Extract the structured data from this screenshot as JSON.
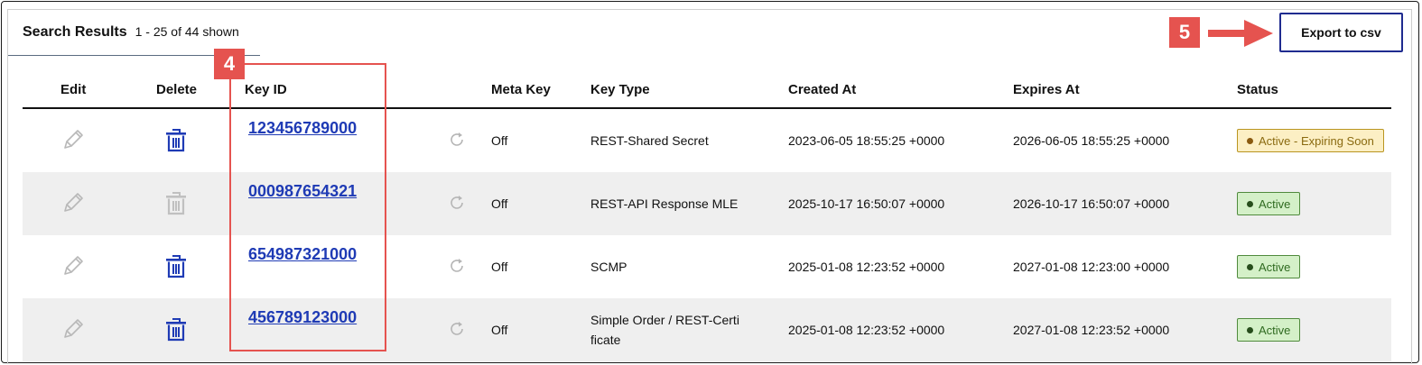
{
  "results": {
    "title": "Search Results",
    "count": "1 - 25 of 44 shown"
  },
  "toolbar": {
    "export_label": "Export to csv"
  },
  "callouts": {
    "export": "5",
    "key_id": "4"
  },
  "columns": {
    "edit": "Edit",
    "delete": "Delete",
    "key_id": "Key ID",
    "meta_key": "Meta Key",
    "key_type": "Key Type",
    "created_at": "Created At",
    "expires_at": "Expires At",
    "status": "Status"
  },
  "rows": [
    {
      "key_id": "123456789000",
      "meta_key": "Off",
      "key_type_1": "REST-Shared Secret",
      "key_type_2": "",
      "created_at": "2023-06-05 18:55:25 +0000",
      "expires_at": "2026-06-05 18:55:25 +0000",
      "status": "Active - Expiring Soon",
      "delete_enabled": true
    },
    {
      "key_id": "000987654321",
      "meta_key": "Off",
      "key_type_1": "REST-API Response MLE",
      "key_type_2": "",
      "created_at": "2025-10-17 16:50:07 +0000",
      "expires_at": "2026-10-17 16:50:07 +0000",
      "status": "Active",
      "delete_enabled": false
    },
    {
      "key_id": "654987321000",
      "meta_key": "Off",
      "key_type_1": "SCMP",
      "key_type_2": "",
      "created_at": "2025-01-08 12:23:52 +0000",
      "expires_at": "2027-01-08 12:23:00 +0000",
      "status": "Active",
      "delete_enabled": true
    },
    {
      "key_id": "456789123000",
      "meta_key": "Off",
      "key_type_1": "Simple Order / REST-Certi",
      "key_type_2": "ficate",
      "created_at": "2025-01-08 12:23:52 +0000",
      "expires_at": "2027-01-08 12:23:52 +0000",
      "status": "Active",
      "delete_enabled": true
    }
  ],
  "colors": {
    "accent": "#1f3bb5",
    "callout": "#e5534f",
    "icon_disabled": "#c0c0c0"
  },
  "icons": {
    "edit": "pencil-icon",
    "delete": "trash-icon",
    "rotate": "rotate-icon"
  }
}
